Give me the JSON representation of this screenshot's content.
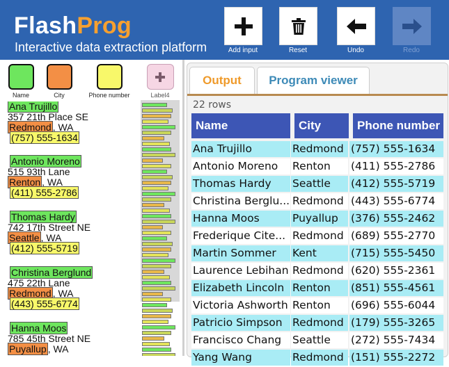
{
  "app": {
    "brand_a": "Flash",
    "brand_b": "Prog",
    "tagline": "Interactive data extraction platform"
  },
  "toolbar": [
    {
      "label": "Add input",
      "icon": "plus-icon",
      "enabled": true
    },
    {
      "label": "Reset",
      "icon": "trash-icon",
      "enabled": true
    },
    {
      "label": "Undo",
      "icon": "arrow-left-icon",
      "enabled": true
    },
    {
      "label": "Redo",
      "icon": "arrow-right-icon",
      "enabled": false
    }
  ],
  "labels": [
    {
      "name": "Name",
      "color": "#6ee65e"
    },
    {
      "name": "City",
      "color": "#f38f45"
    },
    {
      "name": "Phone number",
      "color": "#f8f86a"
    },
    {
      "name": "Label4",
      "color": "#f6d6e4"
    }
  ],
  "records": [
    {
      "name": "Ana Trujillo",
      "street": "357 21th Place SE",
      "city": "Redmond",
      "state": ", WA",
      "phone": "(757) 555-1634"
    },
    {
      "name": "Antonio Moreno",
      "street": "515 93th Lane",
      "city": "Renton",
      "state": ", WA",
      "phone": "(411) 555-2786"
    },
    {
      "name": "Thomas Hardy",
      "street": "742 17th Street NE",
      "city": "Seattle",
      "state": ", WA",
      "phone": "(412) 555-5719"
    },
    {
      "name": "Christina Berglund",
      "street": "475 22th Lane",
      "city": "Redmond",
      "state": ", WA",
      "phone": "(443) 555-6774"
    },
    {
      "name": "Hanna Moos",
      "street": "785 45th Street NE",
      "city": "Puyallup",
      "state": ", WA",
      "phone": ""
    }
  ],
  "tabs": {
    "output": "Output",
    "program": "Program viewer"
  },
  "table": {
    "row_count": "22 rows",
    "headers": [
      "Name",
      "City",
      "Phone number"
    ],
    "rows": [
      [
        "Ana Trujillo",
        "Redmond",
        "(757) 555-1634"
      ],
      [
        "Antonio Moreno",
        "Renton",
        "(411) 555-2786"
      ],
      [
        "Thomas Hardy",
        "Seattle",
        "(412) 555-5719"
      ],
      [
        "Christina Berglu...",
        "Redmond",
        "(443) 555-6774"
      ],
      [
        "Hanna Moos",
        "Puyallup",
        "(376) 555-2462"
      ],
      [
        "Frederique Cite...",
        "Redmond",
        "(689) 555-2770"
      ],
      [
        "Martin Sommer",
        "Kent",
        "(715) 555-5450"
      ],
      [
        "Laurence Lebihan",
        "Redmond",
        "(620) 555-2361"
      ],
      [
        "Elizabeth Lincoln",
        "Renton",
        "(851) 555-4561"
      ],
      [
        "Victoria Ashworth",
        "Renton",
        "(696) 555-6044"
      ],
      [
        "Patricio Simpson",
        "Redmond",
        "(179) 555-3265"
      ],
      [
        "Francisco Chang",
        "Seattle",
        "(272) 555-7434"
      ],
      [
        "Yang Wang",
        "Redmond",
        "(151) 555-2272"
      ]
    ]
  },
  "colors": {
    "header_bg": "#2e64b0",
    "accent": "#f7a02f",
    "table_header": "#3d56b5",
    "row_highlight": "#a9ecf5"
  }
}
